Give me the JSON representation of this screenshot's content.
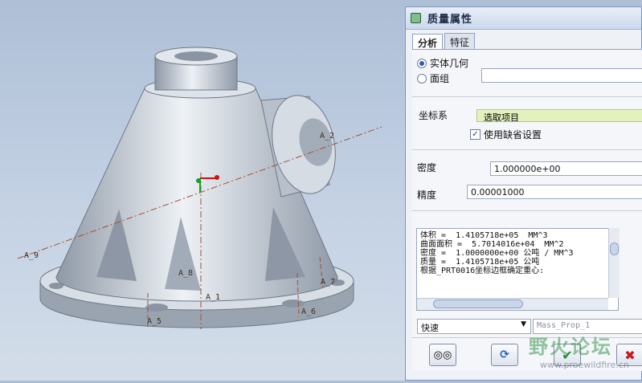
{
  "dialog": {
    "title": "质量属性",
    "tabs": [
      {
        "label": "分析"
      },
      {
        "label": "特征"
      }
    ],
    "radio_solid": "实体几何",
    "radio_quilt": "面组",
    "csys_label": "坐标系",
    "csys_select": "选取项目",
    "use_default_label": "使用缺省设置",
    "density_label": "密度",
    "density_value": "1.000000e+00",
    "accuracy_label": "精度",
    "accuracy_value": "0.00001000",
    "results": [
      "体积 =  1.4105718e+05  MM^3",
      "曲面面积 =  5.7014016e+04  MM^2",
      "密度 =  1.0000000e+00 公吨 / MM^3",
      "质量 =  1.4105718e+05 公吨",
      "",
      "根据_PRT0016坐标边框确定重心:"
    ],
    "mode_select": "快速",
    "analysis_name": "Mass_Prop_1"
  },
  "viewport": {
    "axis_labels": [
      "A_9",
      "A_2",
      "A_8",
      "A_7",
      "A_6",
      "A_5",
      "A_1"
    ]
  },
  "watermark": {
    "text": "野火论坛",
    "url": "www.proewildfire.cn"
  },
  "colors": {
    "viewport_bg": "#c4d2e4",
    "part": "#c8d0da",
    "axis": "#a0522d",
    "accent": "#e3f1bd"
  }
}
